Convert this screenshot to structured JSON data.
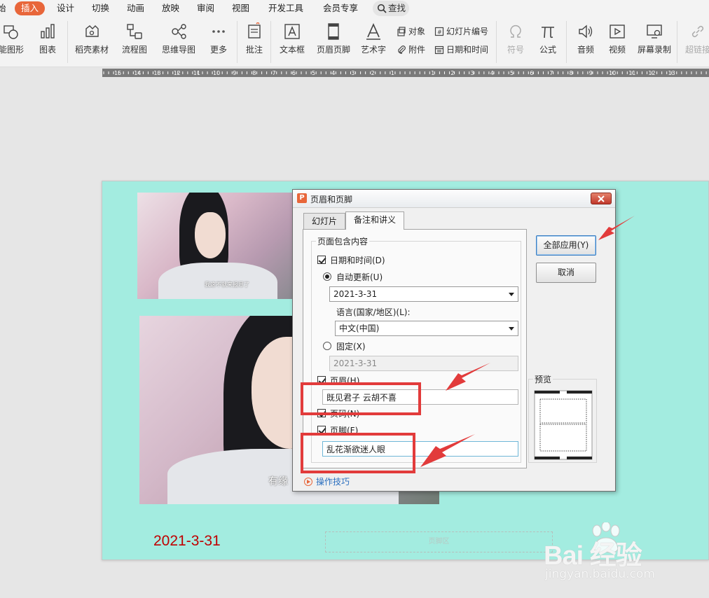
{
  "menu": {
    "items": [
      "始",
      "插入",
      "设计",
      "切换",
      "动画",
      "放映",
      "审阅",
      "视图",
      "开发工具",
      "会员专享"
    ],
    "active_index": 1,
    "search_label": "查找"
  },
  "ribbon": {
    "shape": "能图形",
    "chart": "图表",
    "daoke": "稻壳素材",
    "flow": "流程图",
    "mind": "思维导图",
    "more": "更多",
    "comment": "批注",
    "textbox": "文本框",
    "header_footer": "页眉页脚",
    "wordart": "艺术字",
    "object": "对象",
    "attachment": "附件",
    "slide_number": "幻灯片编号",
    "datetime": "日期和时间",
    "symbol": "符号",
    "formula": "公式",
    "audio": "音频",
    "video": "视频",
    "screen_record": "屏幕录制",
    "hyperlink": "超链接"
  },
  "ruler": {
    "left_labels": [
      "16",
      "15",
      "14",
      "13",
      "12",
      "11",
      "10",
      "9",
      "8",
      "7",
      "6",
      "5",
      "4",
      "3",
      "2",
      "1"
    ],
    "right_labels": [
      "1",
      "2",
      "3",
      "4",
      "5",
      "6",
      "7",
      "8",
      "9",
      "10",
      "11",
      "12",
      "13"
    ]
  },
  "slide": {
    "subtitle1": "我这不就来报恩了",
    "subtitle2": "有缘",
    "date_text": "2021-3-31",
    "footer_placeholder": "页脚区"
  },
  "dialog": {
    "title": "页眉和页脚",
    "tabs": [
      "幻灯片",
      "备注和讲义"
    ],
    "active_tab": 1,
    "group_title": "页面包含内容",
    "datetime_label": "日期和时间(D)",
    "auto_update_label": "自动更新(U)",
    "auto_update_value": "2021-3-31",
    "language_label": "语言(国家/地区)(L):",
    "language_value": "中文(中国)",
    "fixed_label": "固定(X)",
    "fixed_value": "2021-3-31",
    "header_label": "页眉(H)",
    "header_value": "既见君子 云胡不喜",
    "page_number_label": "页码(N)",
    "footer_label": "页脚(F)",
    "footer_value": "乱花渐欲迷人眼",
    "apply_all": "全部应用(Y)",
    "cancel": "取消",
    "preview": "预览",
    "tips": "操作技巧"
  },
  "watermark": {
    "brand": "Bai 经验",
    "domain": "jingyan.baidu.com"
  },
  "colors": {
    "accent": "#e8663a",
    "slide_bg": "#a3ece0",
    "date_red": "#c00000",
    "annotation_red": "#e23b3b"
  }
}
